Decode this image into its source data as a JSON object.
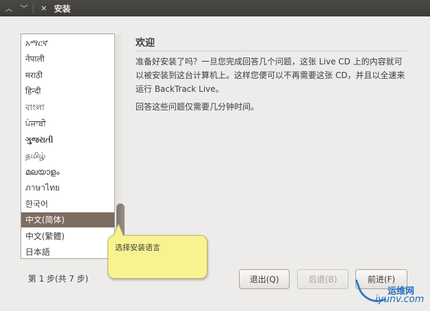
{
  "window": {
    "title": "安装",
    "buttons": [
      {
        "name": "minimize-button",
        "glyph": "︿"
      },
      {
        "name": "maximize-button",
        "glyph": "﹀"
      },
      {
        "name": "close-button",
        "glyph": "✕"
      }
    ]
  },
  "languages": {
    "items": [
      "አማርኛ",
      "नेपाली",
      "मराठी",
      "हिन्दी",
      "বাংলা",
      "ਪੰਜਾਬੀ",
      "ગુજરાતી",
      "தமிழ்",
      "മലയാളം",
      "ภาษาไทย",
      "한국어",
      "中文(简体)",
      "中文(繁體)",
      "日本語"
    ],
    "selected": "中文(简体)"
  },
  "main": {
    "heading": "欢迎",
    "paragraph1": "准备好安装了吗？一旦您完成回答几个问题，这张 Live CD 上的内容就可以被安装到这台计算机上。这样您便可以不再需要这张 CD，并且以全速来运行 BackTrack Live。",
    "paragraph2": "回答这些问题仅需要几分钟时间。"
  },
  "tooltip": {
    "text": "选择安装语言"
  },
  "footer": {
    "step": "第 1 步(共 7 步)",
    "quit_label": "退出(Q)",
    "back_label": "后退(B)",
    "forward_label": "前进(F)"
  },
  "watermark": {
    "cn": "运维网",
    "en": "iyunv.com"
  },
  "colors": {
    "titlebar": "#3c3b37",
    "background": "#edeceb",
    "selected_row": "#7e6b61",
    "tooltip": "#f8f290",
    "watermark": "#1f6fbf"
  }
}
